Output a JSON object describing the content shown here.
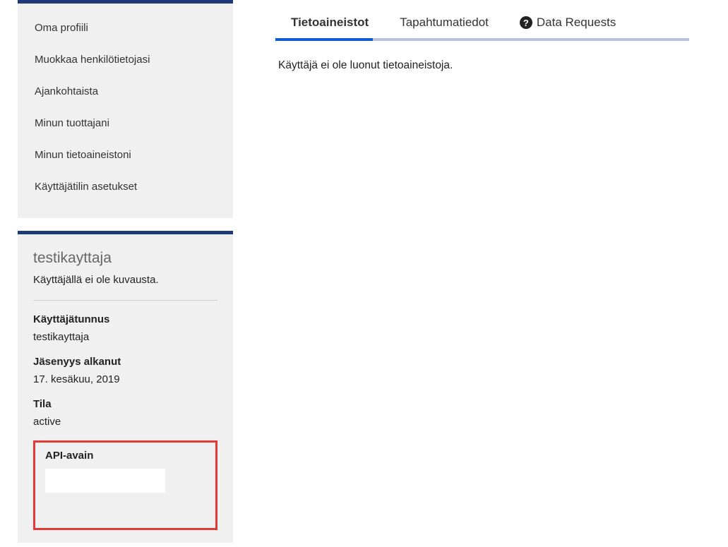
{
  "sidebar": {
    "nav_items": [
      {
        "label": "Oma profiili"
      },
      {
        "label": "Muokkaa henkilötietojasi"
      },
      {
        "label": "Ajankohtaista"
      },
      {
        "label": "Minun tuottajani"
      },
      {
        "label": "Minun tietoaineistoni"
      },
      {
        "label": "Käyttäjätilin asetukset"
      }
    ],
    "info": {
      "title": "testikayttaja",
      "description": "Käyttäjällä ei ole kuvausta.",
      "username_label": "Käyttäjätunnus",
      "username_value": "testikayttaja",
      "member_since_label": "Jäsenyys alkanut",
      "member_since_value": "17. kesäkuu, 2019",
      "state_label": "Tila",
      "state_value": "active",
      "api_key_label": "API-avain"
    }
  },
  "main": {
    "tabs": {
      "datasets": "Tietoaineistot",
      "activity": "Tapahtumatiedot",
      "data_requests": "Data Requests"
    },
    "empty_message": "Käyttäjä ei ole luonut tietoaineistoja."
  }
}
